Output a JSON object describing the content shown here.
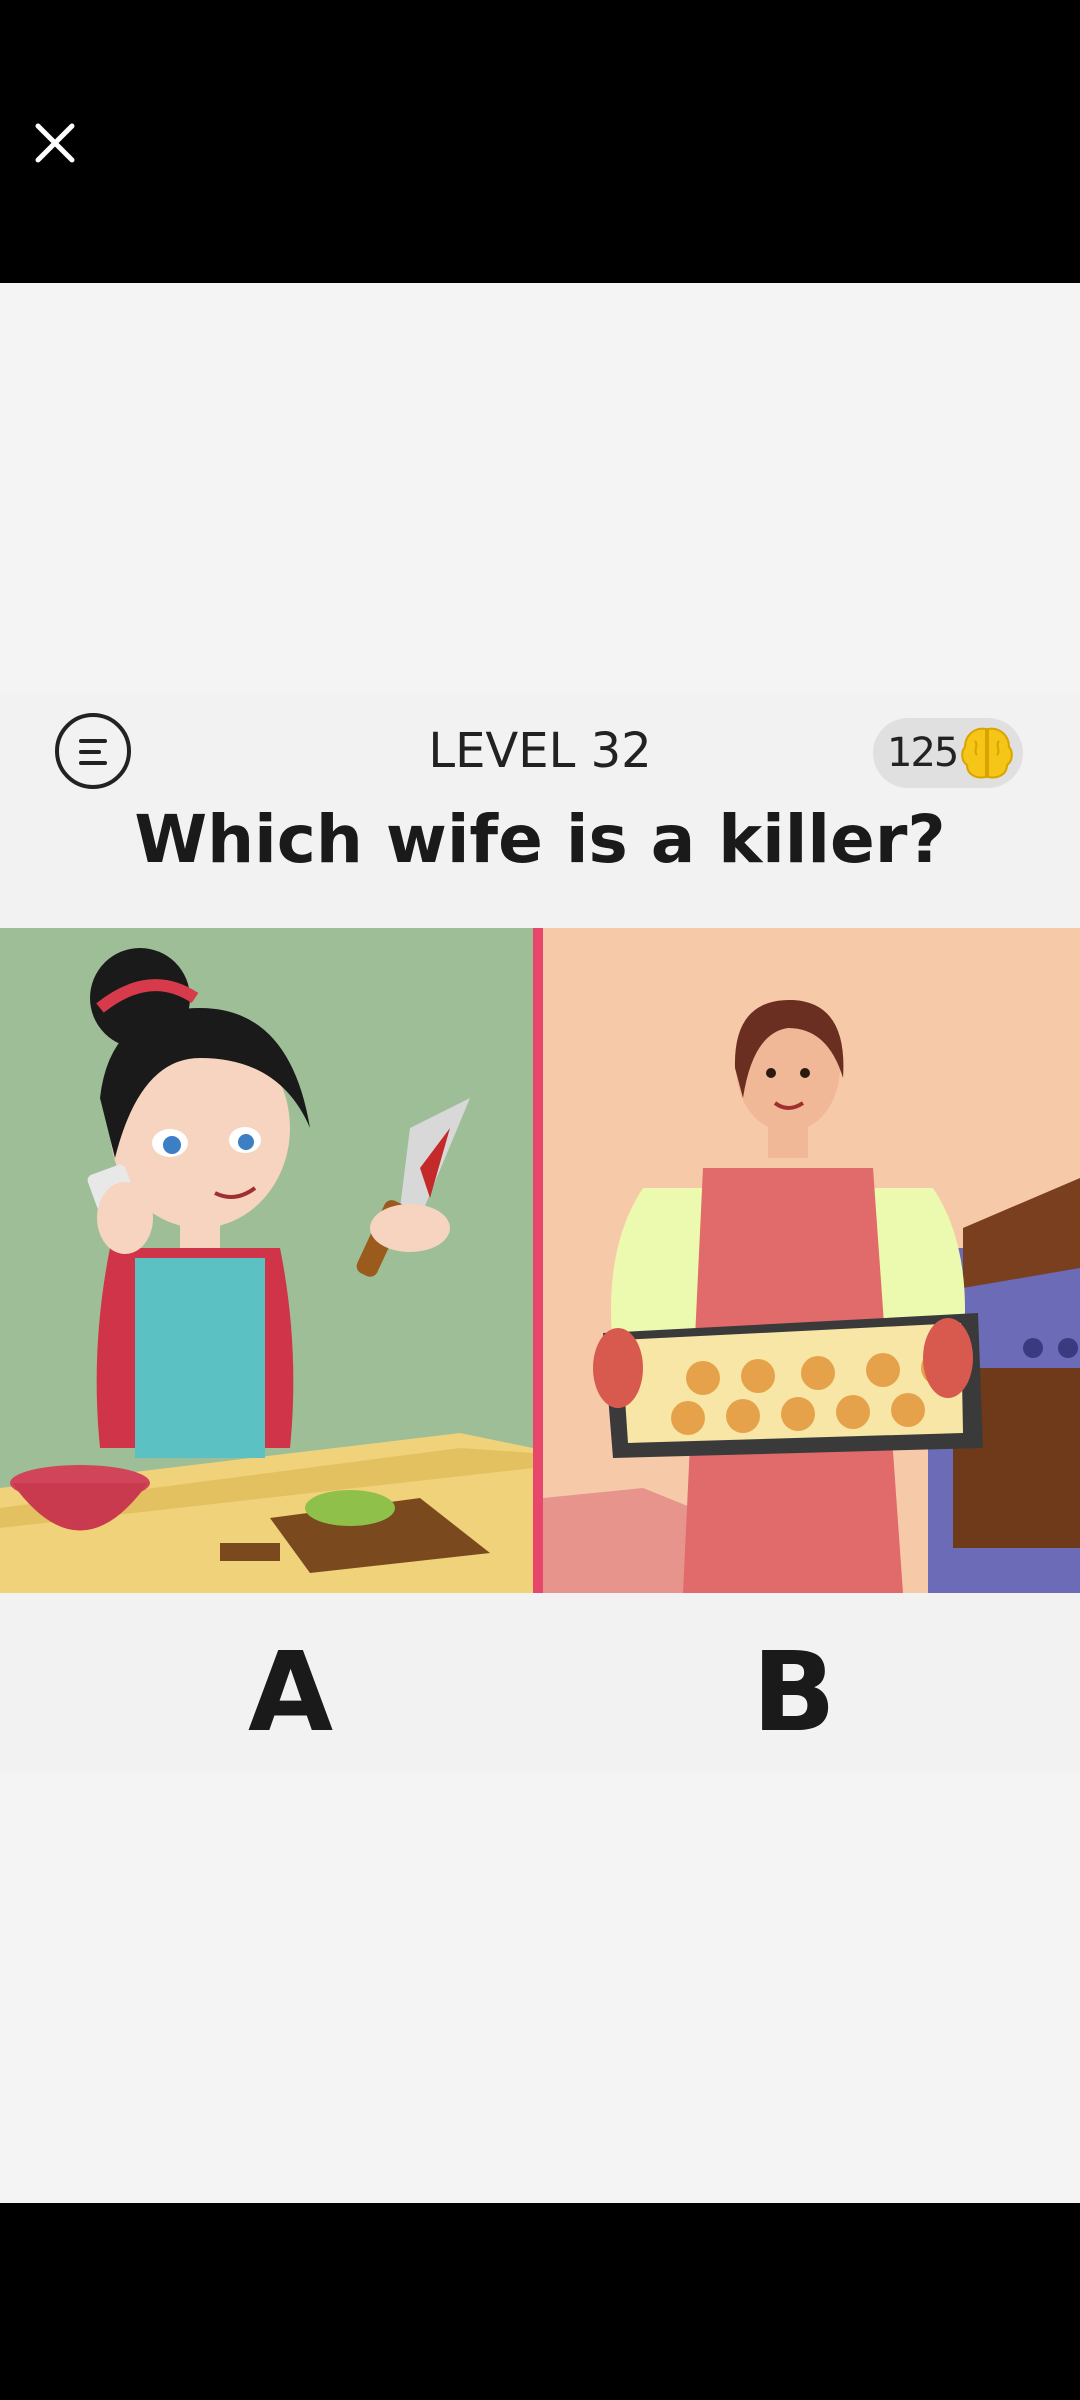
{
  "header": {
    "close_icon": "close-icon"
  },
  "game": {
    "level_label": "LEVEL 32",
    "score": "125",
    "score_icon": "brain-icon",
    "menu_icon": "menu-icon",
    "question": "Which wife is a killer?",
    "options": [
      {
        "label": "A",
        "scene": "woman on phone holding bloody knife in kitchen"
      },
      {
        "label": "B",
        "scene": "woman in apron holding tray of cookies by oven"
      }
    ]
  },
  "colors": {
    "panel_a_bg": "#9ebe97",
    "panel_b_bg": "#f6c9a8",
    "divider": "#e6476a",
    "brain": "#f5c518"
  }
}
